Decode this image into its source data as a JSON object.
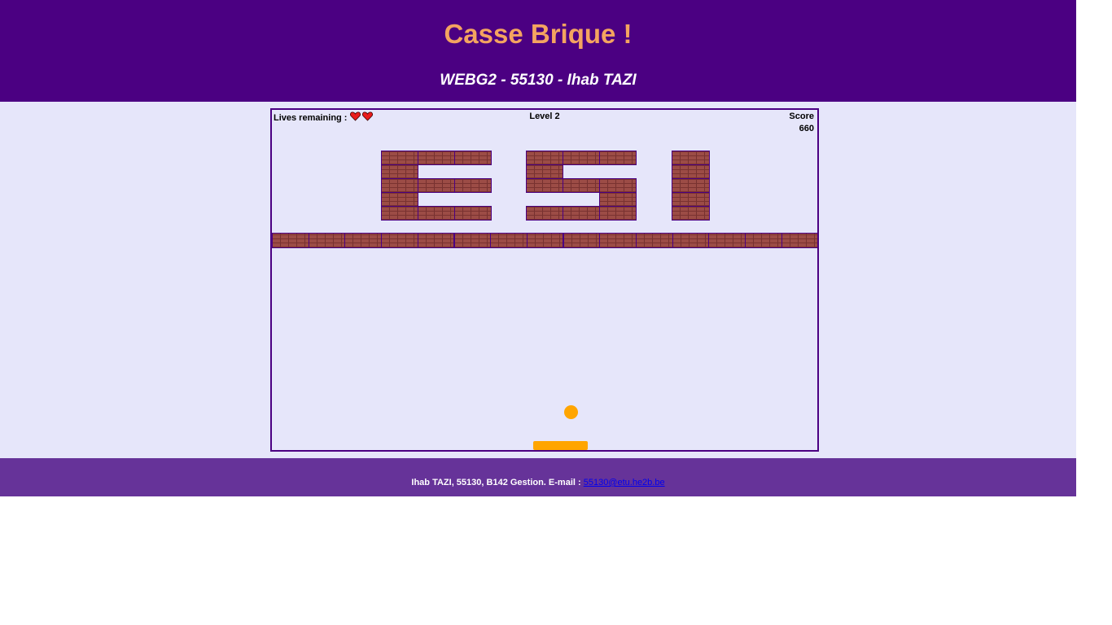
{
  "header": {
    "title": "Casse Brique !",
    "subtitle": "WEBG2 - 55130 - Ihab TAZI",
    "title_color": "#f4a460",
    "background": "#4b0082"
  },
  "game": {
    "lives_label": "Lives remaining :",
    "lives_count": 2,
    "life_icon": "heart-icon",
    "level_label": "Level 2",
    "score_label": "Score",
    "score_value": "660",
    "ball_color": "#ffa500",
    "paddle_color": "#ffa500",
    "background": "#e6e6fa"
  },
  "footer": {
    "text": "Ihab TAZI, 55130, B142 Gestion. E-mail :",
    "email": "55130@etu.he2b.be",
    "background": "#663399"
  }
}
